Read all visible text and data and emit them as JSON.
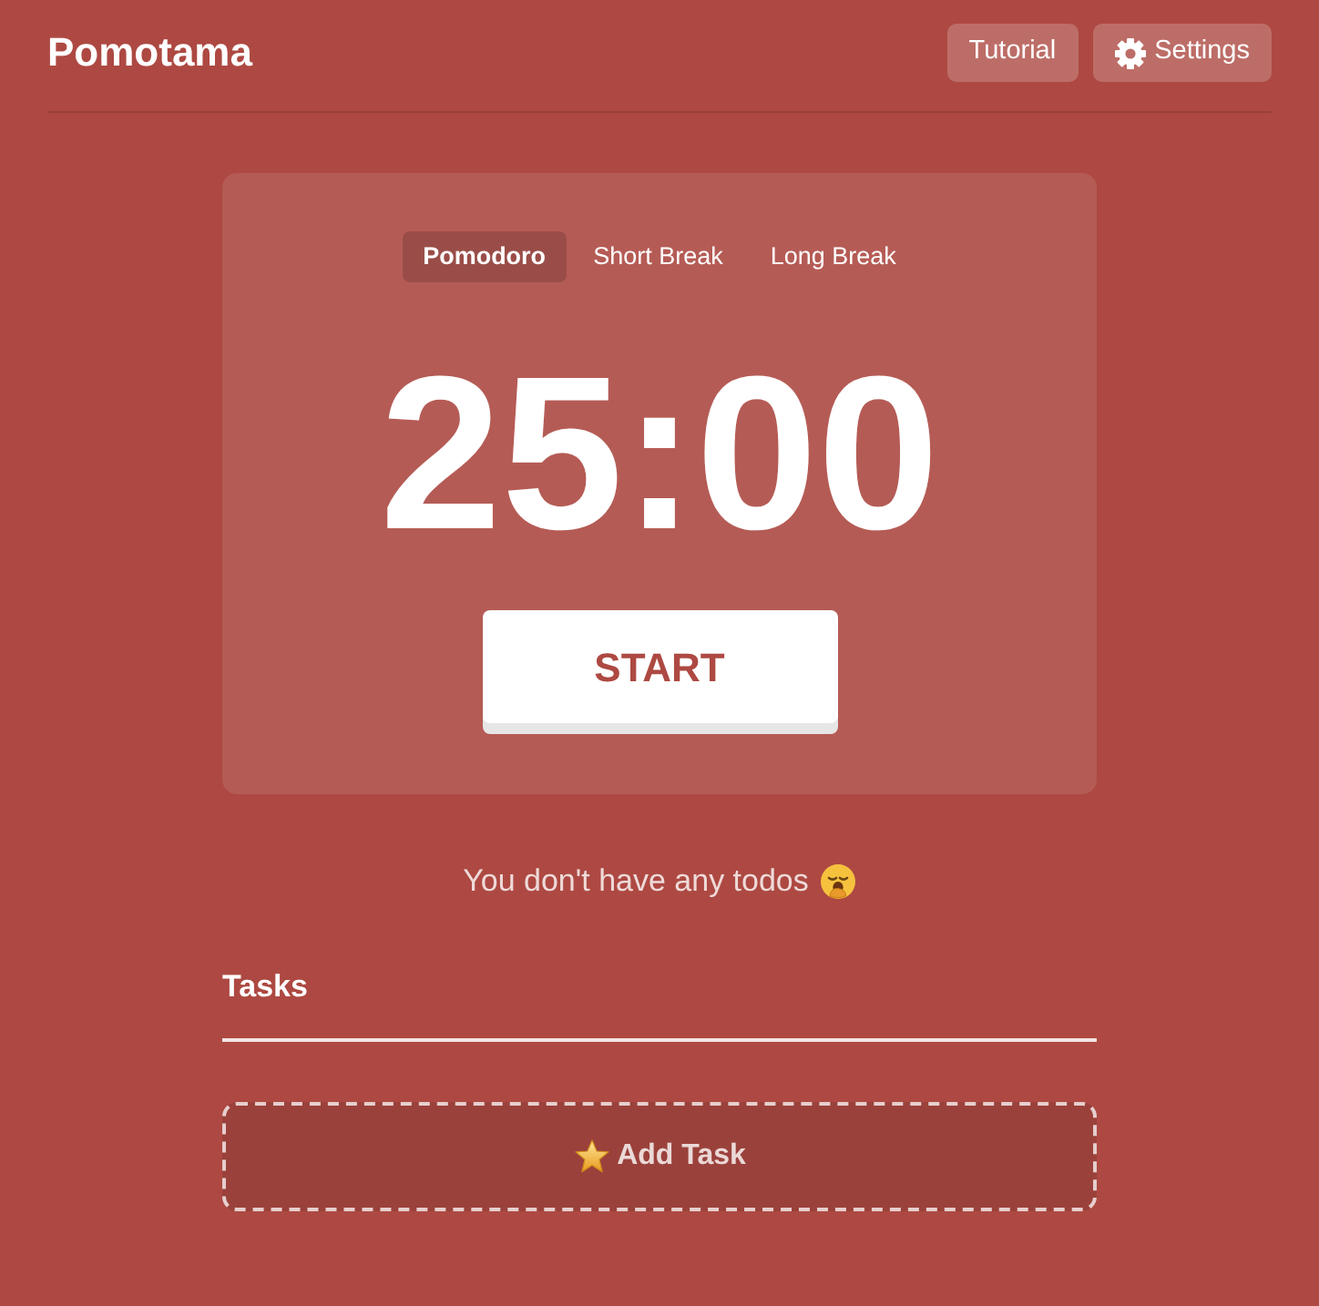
{
  "header": {
    "title": "Pomotama",
    "tutorial_button": "Tutorial",
    "settings_button": "Settings"
  },
  "timer": {
    "modes": [
      {
        "label": "Pomodoro",
        "selected": true
      },
      {
        "label": "Short Break",
        "selected": false
      },
      {
        "label": "Long Break",
        "selected": false
      }
    ],
    "time": "25:00",
    "start_button": "START"
  },
  "todos": {
    "empty_message": "You don't have any todos"
  },
  "tasks": {
    "title": "Tasks",
    "add_button": "Add Task"
  }
}
